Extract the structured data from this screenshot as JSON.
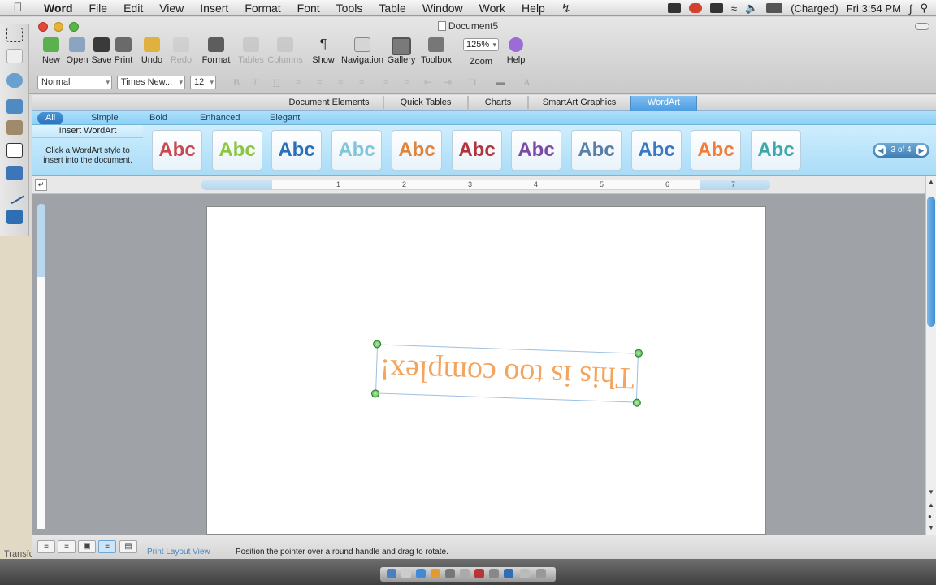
{
  "menubar": {
    "apple": "",
    "menus": [
      "Word",
      "File",
      "Edit",
      "View",
      "Insert",
      "Format",
      "Font",
      "Tools",
      "Table",
      "Window",
      "Work",
      "Help"
    ],
    "battery": "(Charged)",
    "clock": "Fri 3:54 PM"
  },
  "window": {
    "title": "Document5"
  },
  "toolbar": {
    "new": "New",
    "open": "Open",
    "save": "Save",
    "print": "Print",
    "undo": "Undo",
    "redo": "Redo",
    "format": "Format",
    "tables": "Tables",
    "columns": "Columns",
    "show": "Show",
    "navigation": "Navigation",
    "gallery": "Gallery",
    "toolbox": "Toolbox",
    "zoom_value": "125%",
    "zoom": "Zoom",
    "help": "Help"
  },
  "formatting": {
    "style": "Normal",
    "font": "Times New...",
    "size": "12"
  },
  "gallery_tabs": [
    "Document Elements",
    "Quick Tables",
    "Charts",
    "SmartArt Graphics",
    "WordArt"
  ],
  "gallery_active_tab": "WordArt",
  "gallery_groups": [
    "All",
    "Simple",
    "Bold",
    "Enhanced",
    "Elegant"
  ],
  "gallery_active_group": "All",
  "gallery_info": {
    "heading": "Insert WordArt",
    "description": "Click a WordArt style to insert into the document."
  },
  "wordart_styles": [
    "Abc",
    "Abc",
    "Abc",
    "Abc",
    "Abc",
    "Abc",
    "Abc",
    "Abc",
    "Abc",
    "Abc",
    "Abc"
  ],
  "wordart_colors": [
    "#c9494f",
    "#8cc63f",
    "#2a6fb8",
    "#7fc6d9",
    "#e0843c",
    "#b2333a",
    "#7b4aa8",
    "#5a7fa6",
    "#3b78c4",
    "#ef7e3a",
    "#3fa7a8"
  ],
  "gallery_page": "3 of 4",
  "ruler_numbers": [
    "1",
    "2",
    "3",
    "4",
    "5",
    "6",
    "7"
  ],
  "document": {
    "wordart_text": "This is too complex!"
  },
  "statusbar": {
    "view_name": "Print Layout View",
    "hint": "Position the pointer over a round handle and drag to rotate."
  },
  "left_panel_label": "Transfo",
  "colors": {
    "accent": "#4e9ee3",
    "wordart_text": "#f3a55f",
    "handle": "#3ea83a"
  }
}
